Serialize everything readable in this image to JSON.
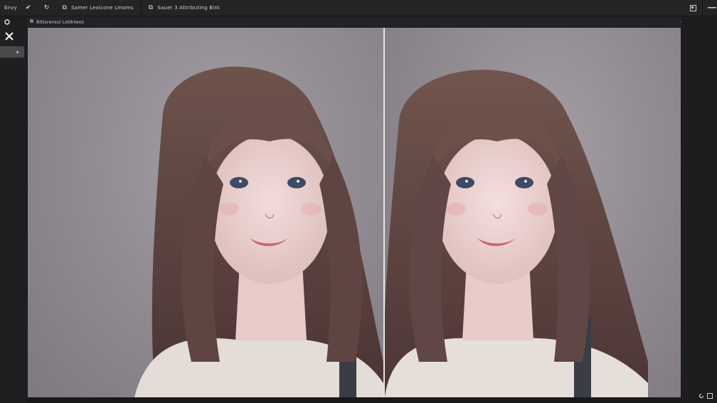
{
  "topbar": {
    "items": [
      {
        "glyph": "",
        "label": "Envy"
      },
      {
        "glyph": "✔",
        "label": ""
      },
      {
        "glyph": "↻",
        "label": ""
      },
      {
        "glyph": "⧉",
        "label": "Samer  Lexicone  Lmoms"
      },
      {
        "glyph": "⧉",
        "label": "Sauer  3  Attributing  Bint"
      }
    ]
  },
  "subbar": {
    "glyph": "⧉",
    "label": "Bittsrensul  Lotikiwos"
  },
  "leftbar": {
    "tab_plus": "+"
  },
  "colors": {
    "app_bg": "#1c1c1e",
    "panel": "#242426",
    "canvas_bg": "#8d878d",
    "divider": "#e6e6e6"
  }
}
